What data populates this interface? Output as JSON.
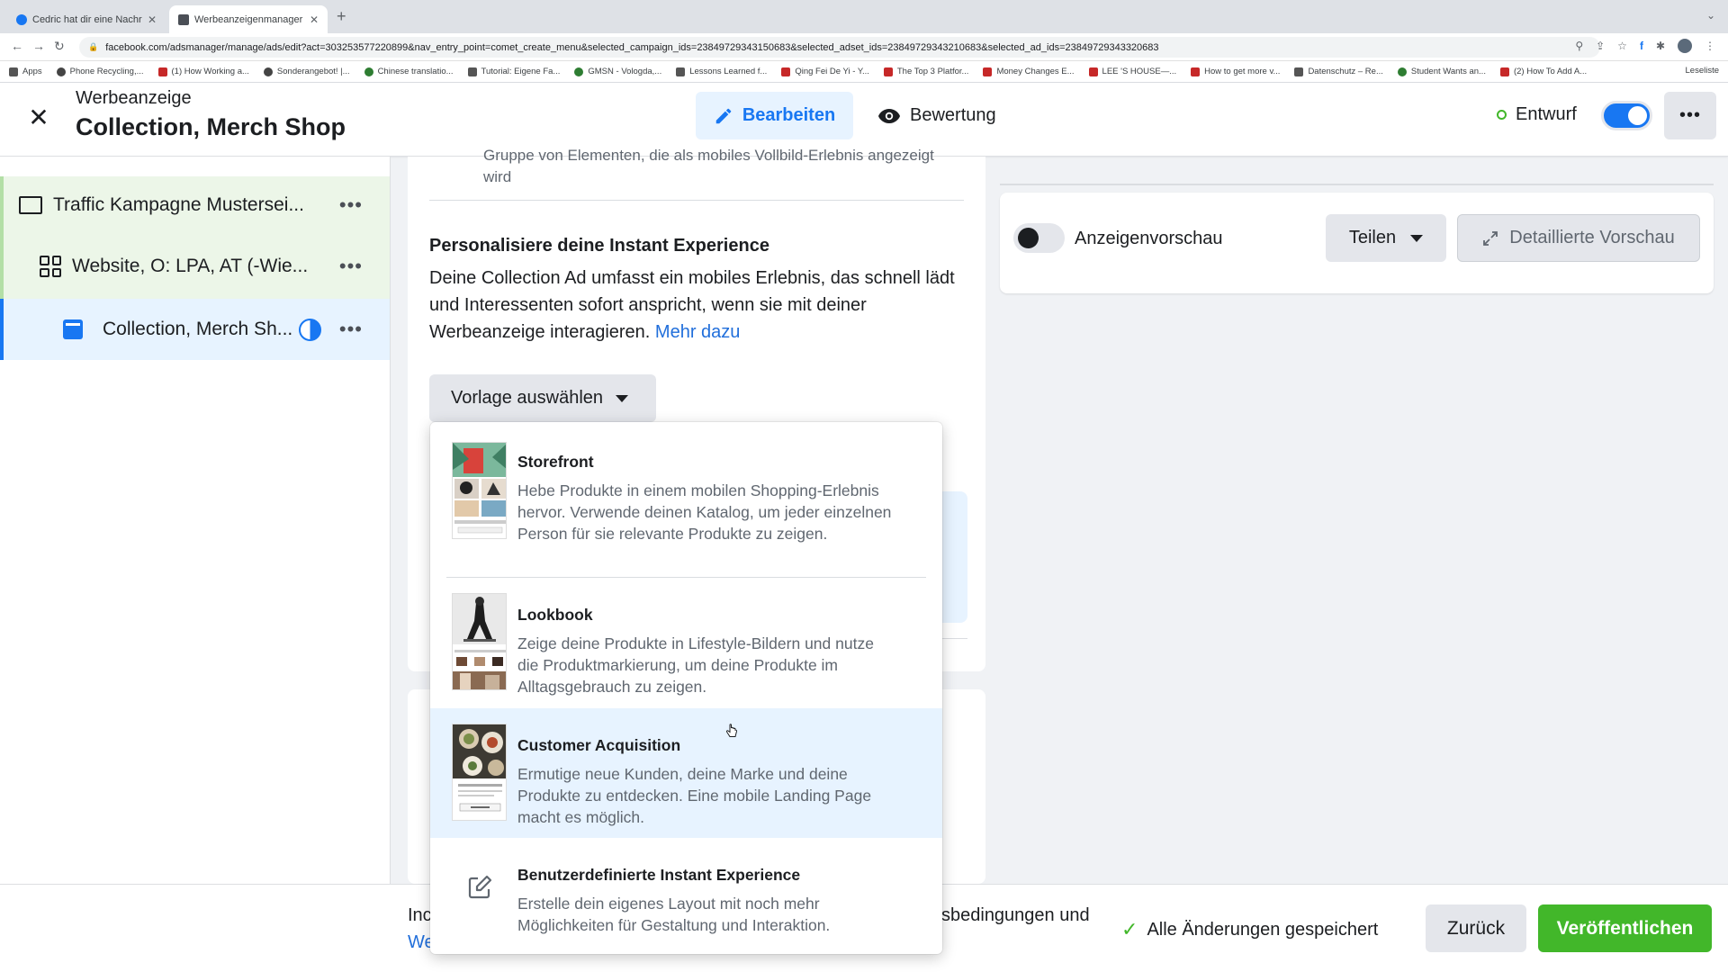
{
  "browser": {
    "tabs": [
      {
        "title": "Cedric hat dir eine Nachricht g"
      },
      {
        "title": "Werbeanzeigenmanager - Wer"
      }
    ],
    "url": "facebook.com/adsmanager/manage/ads/edit?act=303253577220899&nav_entry_point=comet_create_menu&selected_campaign_ids=23849729343150683&selected_adset_ids=23849729343210683&selected_ad_ids=23849729343320683",
    "bookmarks": [
      "Apps",
      "Phone Recycling,...",
      "(1) How Working a...",
      "Sonderangebot! |...",
      "Chinese translatio...",
      "Tutorial: Eigene Fa...",
      "GMSN - Vologda,...",
      "Lessons Learned f...",
      "Qing Fei De Yi - Y...",
      "The Top 3 Platfor...",
      "Money Changes E...",
      "LEE 'S HOUSE—...",
      "How to get more v...",
      "Datenschutz – Re...",
      "Student Wants an...",
      "(2) How To Add A..."
    ],
    "reading_list": "Leseliste"
  },
  "header": {
    "subtitle": "Werbeanzeige",
    "title": "Collection, Merch Shop",
    "edit_label": "Bearbeiten",
    "review_label": "Bewertung",
    "status_label": "Entwurf",
    "more_label": "•••"
  },
  "sidebar": {
    "items": [
      {
        "label": "Traffic Kampagne Mustersei..."
      },
      {
        "label": "Website, O: LPA, AT (-Wie..."
      },
      {
        "label": "Collection, Merch Sh..."
      }
    ],
    "dots": "•••"
  },
  "form": {
    "cut_text_1": "Gruppe von Elementen, die als mobiles Vollbild-Erlebnis angezeigt",
    "cut_text_2": "wird",
    "section_title": "Personalisiere deine Instant Experience",
    "section_desc": "Deine Collection Ad umfasst ein mobiles Erlebnis, das schnell lädt und Interessenten sofort anspricht, wenn sie mit deiner Werbeanzeige interagieren.",
    "more_link": "Mehr dazu",
    "template_button": "Vorlage auswählen"
  },
  "template_menu": {
    "options": [
      {
        "title": "Storefront",
        "desc": "Hebe Produkte in einem mobilen Shopping-Erlebnis hervor. Verwende deinen Katalog, um jeder einzelnen Person für sie relevante Produkte zu zeigen."
      },
      {
        "title": "Lookbook",
        "desc": "Zeige deine Produkte in Lifestyle-Bildern und nutze die Produktmarkierung, um deine Produkte im Alltagsgebrauch zu zeigen."
      },
      {
        "title": "Customer Acquisition",
        "desc": "Ermutige neue Kunden, deine Marke und deine Produkte zu entdecken. Eine mobile Landing Page macht es möglich."
      },
      {
        "title": "Benutzerdefinierte Instant Experience",
        "desc": "Erstelle dein eigenes Layout mit noch mehr Möglichkeiten für Gestaltung und Interaktion."
      }
    ]
  },
  "preview": {
    "toggle_label": "Anzeigenvorschau",
    "share_label": "Teilen",
    "detail_label": "Detaillierte Vorschau"
  },
  "footer": {
    "left_line1": "Inc",
    "left_line2": "We",
    "mid_text": "sbedingungen und",
    "saved_label": "Alle Änderungen gespeichert",
    "back_label": "Zurück",
    "publish_label": "Veröffentlichen"
  },
  "colors": {
    "accent": "#1877f2",
    "publish": "#42b72a",
    "hover": "#e7f3ff",
    "tree_green": "#ecf6e8"
  }
}
